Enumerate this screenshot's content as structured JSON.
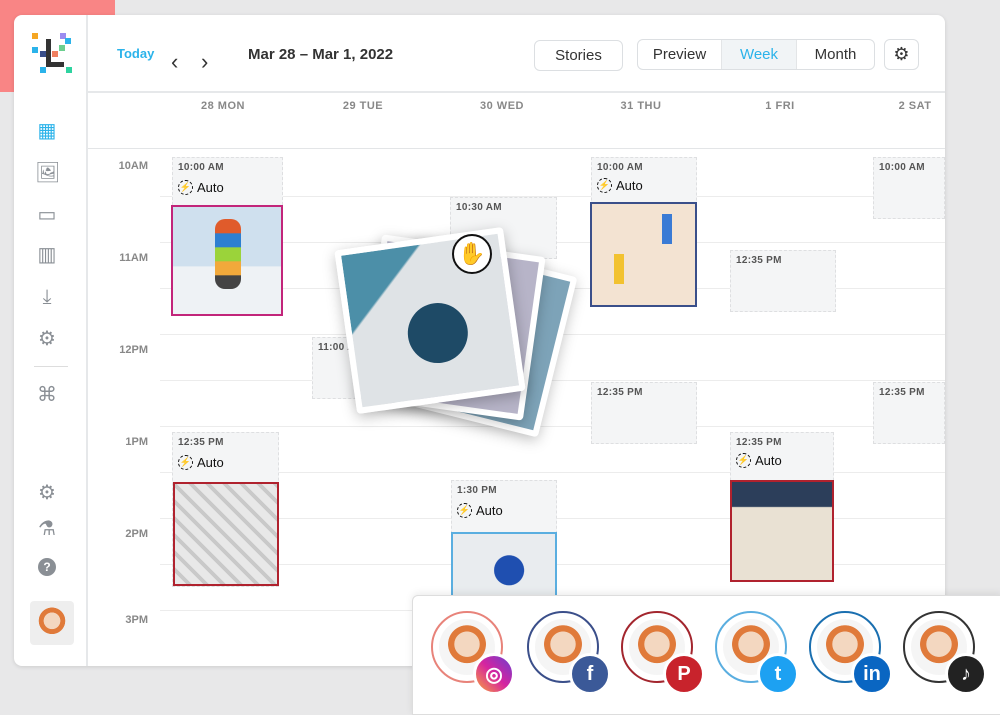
{
  "header": {
    "today": "Today",
    "prev": "‹",
    "next": "›",
    "range": "Mar 28 – Mar 1, 2022",
    "stories": "Stories",
    "views": [
      "Preview",
      "Week",
      "Month"
    ],
    "active_view": "Week",
    "accent": "#2bb3ea"
  },
  "sidebar": {
    "icons": [
      "calendar-icon",
      "gallery-icon",
      "comments-icon",
      "analytics-icon",
      "inbox-icon",
      "automation-icon",
      "integrations-icon",
      "settings-icon",
      "lab-icon",
      "help-icon"
    ],
    "help": "?"
  },
  "days": [
    "28 MON",
    "29 TUE",
    "30 WED",
    "31 THU",
    "1 FRI",
    "2 SAT"
  ],
  "hours": [
    "10AM",
    "11AM",
    "12PM",
    "1PM",
    "2PM",
    "3PM"
  ],
  "slots": {
    "mon1": "10:00 AM",
    "mon2": "12:35 PM",
    "tue1": "11:00 A",
    "wed1": "10:30 AM",
    "wed2": "1:30 PM",
    "thu1": "10:00 AM",
    "thu2": "12:35 PM",
    "fri1": "12:35 PM",
    "fri2": "12:35 PM",
    "sat1": "10:00 AM",
    "sat2": "12:35 PM"
  },
  "auto_label": "Auto",
  "social": [
    {
      "name": "instagram",
      "color": "#e8837a",
      "badge": "#c13584",
      "glyph": "◎"
    },
    {
      "name": "facebook",
      "color": "#3b4f8a",
      "badge": "#1877f2",
      "glyph": "f"
    },
    {
      "name": "pinterest",
      "color": "#a3262e",
      "badge": "#c8232c",
      "glyph": "P"
    },
    {
      "name": "twitter",
      "color": "#5aaee0",
      "badge": "#1da1f2",
      "glyph": "t"
    },
    {
      "name": "linkedin",
      "color": "#1a6fb0",
      "badge": "#0a66c2",
      "glyph": "in"
    },
    {
      "name": "tiktok",
      "color": "#333333",
      "badge": "#111111",
      "glyph": "♪"
    }
  ]
}
